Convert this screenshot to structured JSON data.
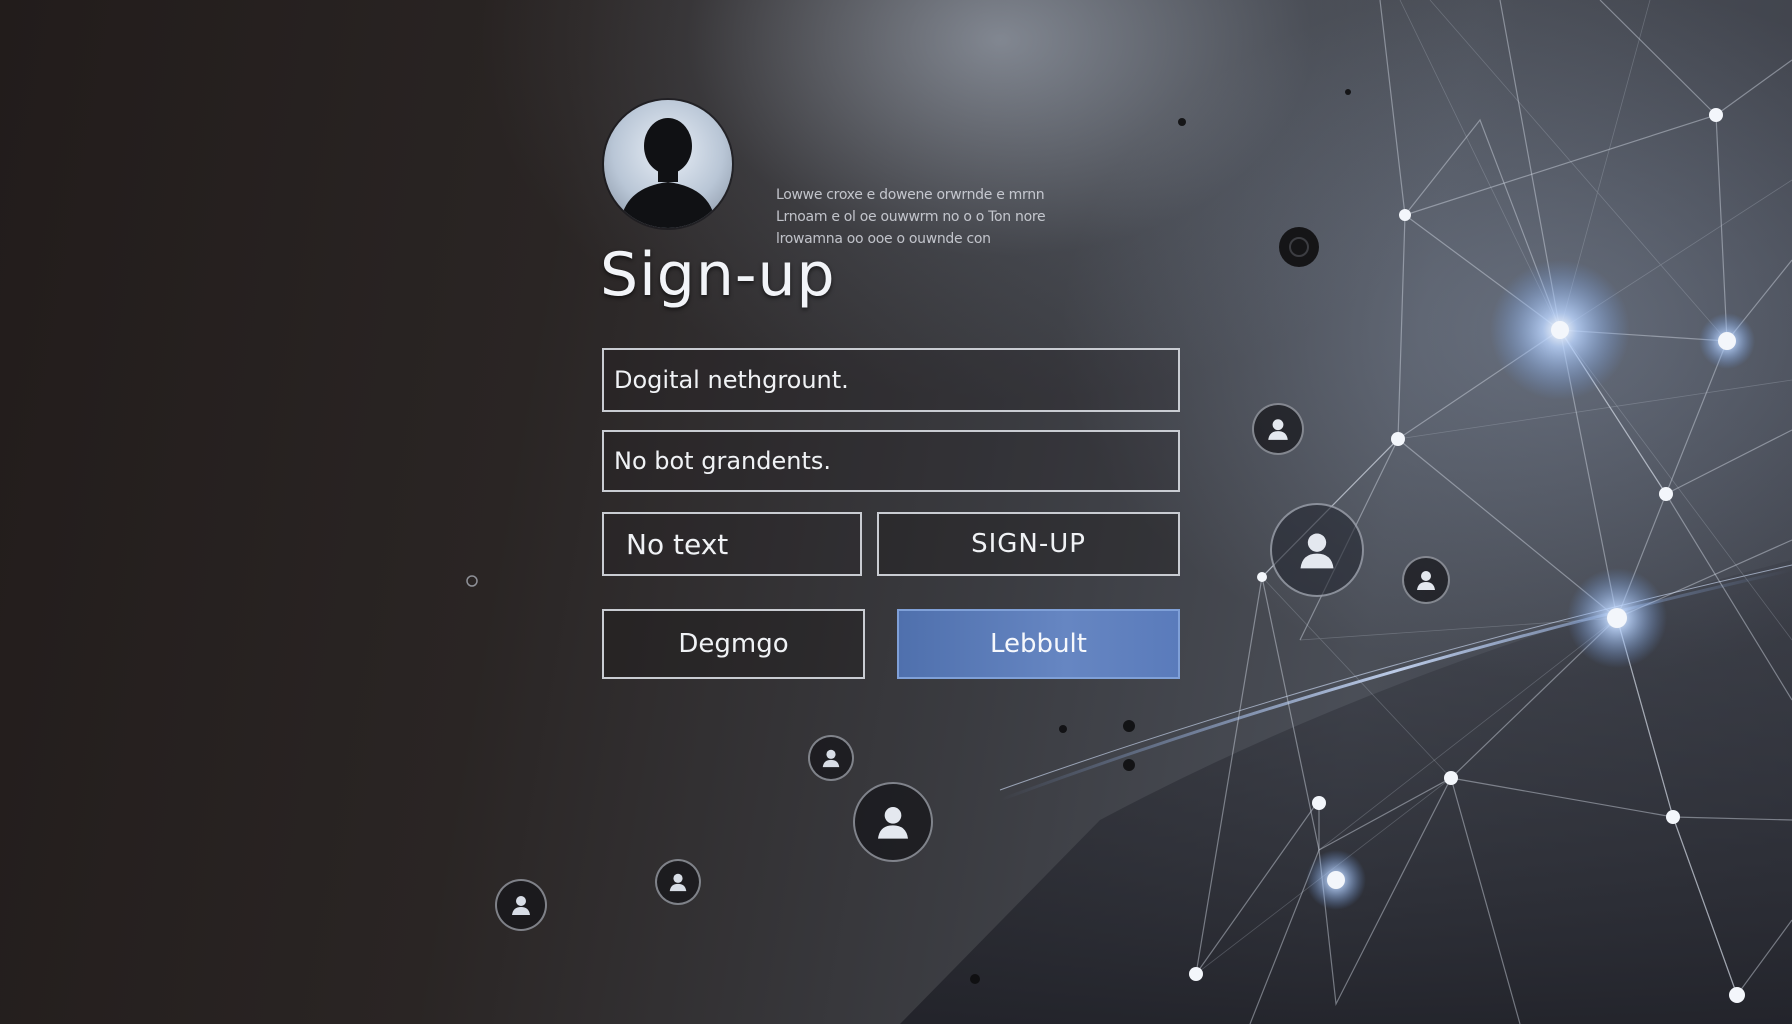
{
  "header": {
    "title": "Sign-up",
    "description_lines": [
      "Lowwe croxe e dowene orwrnde e mrnn",
      "Lrnoam e ol oe ouwwrm no o o Ton nore",
      "lrowamna oo ooe o ouwnde con"
    ]
  },
  "form": {
    "field1_value": "Dogital nethgrount.",
    "field2_value": "No bot grandents.",
    "text_box_label": "No text",
    "signup_button_label": "SIGN-UP",
    "secondary_button_label": "Degmgo",
    "primary_button_label": "Lebbult"
  },
  "icons": {
    "avatar": "user-silhouette-icon",
    "network_avatars": "user-icon",
    "background": "network-graph"
  },
  "colors": {
    "primary_button": "#5a7bbb",
    "glow": "#9ec4ff",
    "field_border": "#c9ccd2"
  }
}
